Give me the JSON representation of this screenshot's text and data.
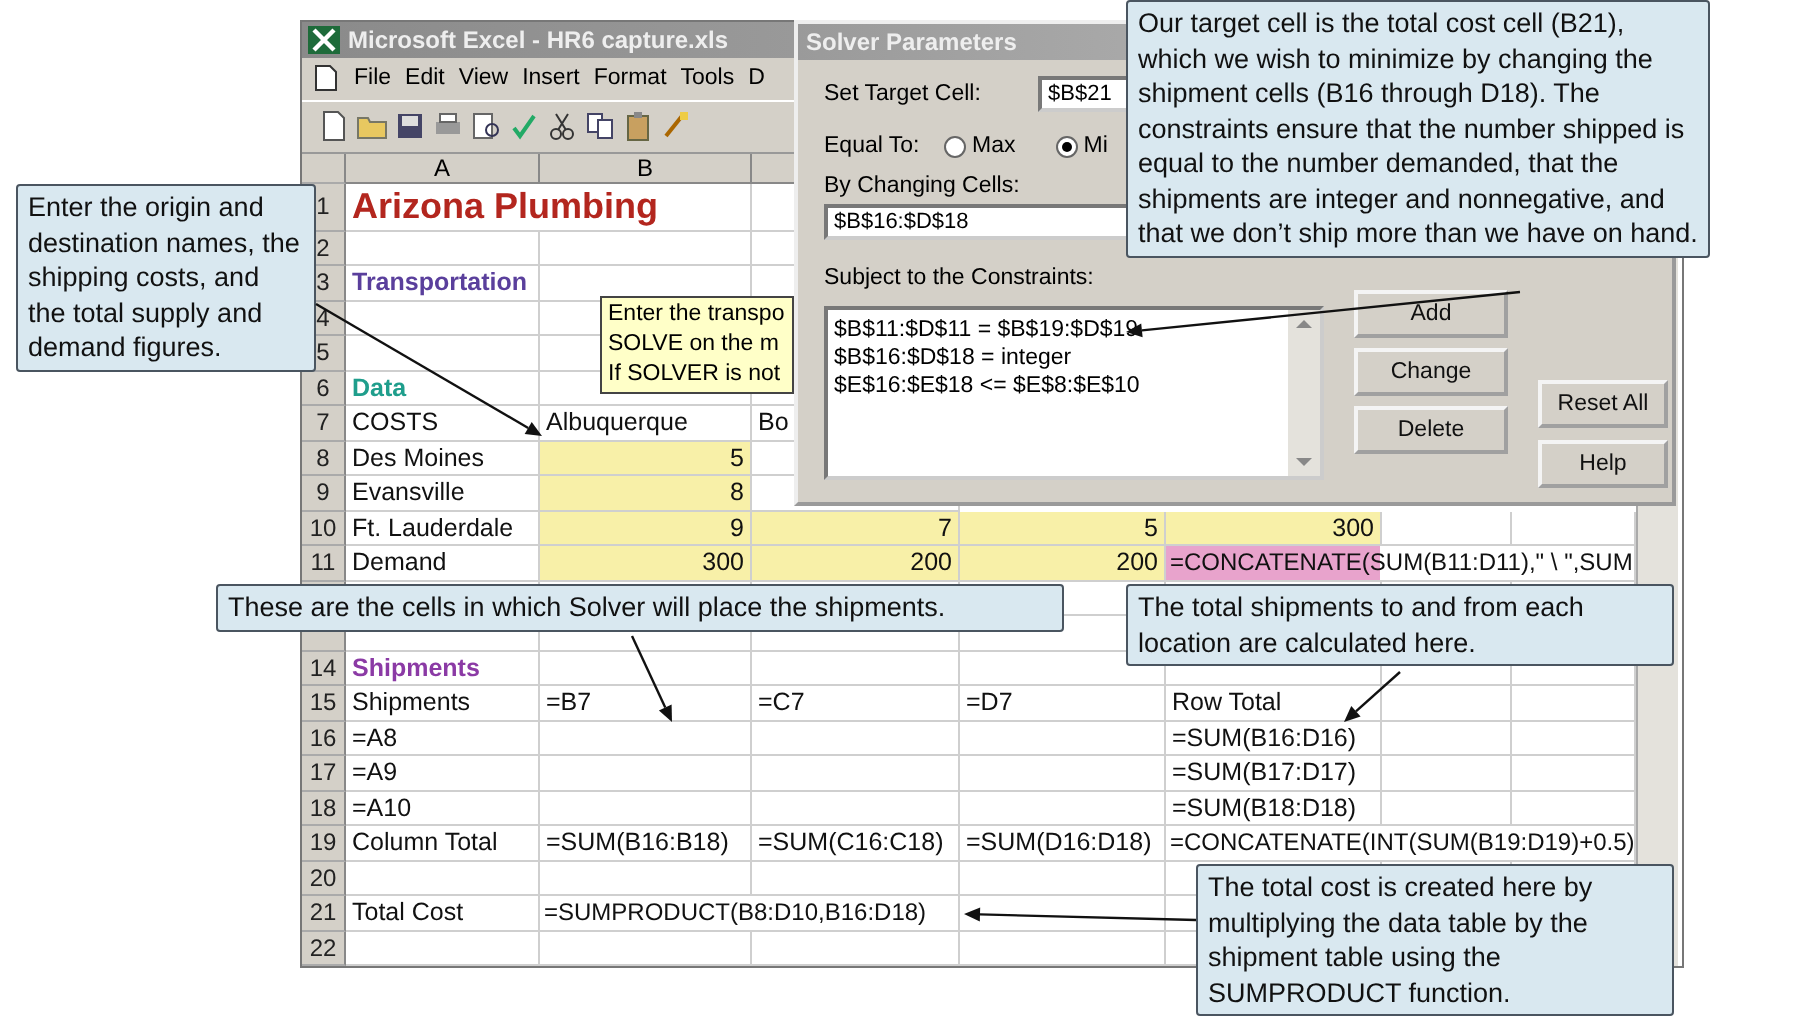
{
  "excel": {
    "title": "Microsoft Excel - HR6 capture.xls",
    "menu": [
      "File",
      "Edit",
      "View",
      "Insert",
      "Format",
      "Tools",
      "D"
    ],
    "columns": [
      "A",
      "B"
    ],
    "rows": [
      {
        "number": "1",
        "a": {
          "text": "Arizona Plumbing",
          "kind": "title"
        }
      },
      {
        "number": "2"
      },
      {
        "number": "3",
        "a": {
          "text": "Transportation",
          "kind": "heading",
          "color": "#5a3f9c"
        }
      },
      {
        "number": "4"
      },
      {
        "number": "5"
      },
      {
        "number": "6",
        "a": {
          "text": "Data",
          "kind": "heading",
          "color": "#1f9e8c"
        }
      },
      {
        "number": "7",
        "a": {
          "text": "COSTS",
          "kind": "text"
        },
        "b": {
          "text": "Albuquerque",
          "kind": "text"
        },
        "c": {
          "text": "Bo",
          "kind": "text"
        }
      },
      {
        "number": "8",
        "a": {
          "text": "Des Moines",
          "kind": "text"
        },
        "b": {
          "text": "5",
          "kind": "number",
          "color": "#f8f0a8"
        }
      },
      {
        "number": "9",
        "a": {
          "text": "Evansville",
          "kind": "text"
        },
        "b": {
          "text": "8",
          "kind": "number",
          "color": "#f8f0a8"
        }
      },
      {
        "number": "10",
        "a": {
          "text": "Ft. Lauderdale",
          "kind": "text"
        },
        "b": {
          "text": "9",
          "kind": "number",
          "color": "#f8f0a8"
        },
        "c": {
          "text": "7",
          "kind": "number",
          "color": "#f8f0a8"
        },
        "d": {
          "text": "5",
          "kind": "number",
          "color": "#f8f0a8"
        },
        "e": {
          "text": "300",
          "kind": "number",
          "color": "#f8f0a8"
        }
      },
      {
        "number": "11",
        "a": {
          "text": "Demand",
          "kind": "text"
        },
        "b": {
          "text": "300",
          "kind": "number",
          "color": "#f8f0a8"
        },
        "c": {
          "text": "200",
          "kind": "number",
          "color": "#f8f0a8"
        },
        "d": {
          "text": "200",
          "kind": "number",
          "color": "#f8f0a8"
        },
        "e": {
          "text": "=CONCATENATE(SUM(B11:D11),\" \\ \",SUM",
          "kind": "overflow",
          "color": "#e8a3cc"
        }
      },
      {},
      {},
      {
        "number": "14",
        "a": {
          "text": "Shipments",
          "kind": "heading",
          "color": "#8b3aa5"
        }
      },
      {
        "number": "15",
        "a": {
          "text": "Shipments",
          "kind": "text"
        },
        "b": {
          "text": "=B7",
          "kind": "text"
        },
        "c": {
          "text": "=C7",
          "kind": "text"
        },
        "d": {
          "text": "=D7",
          "kind": "text"
        },
        "e": {
          "text": "Row Total",
          "kind": "text"
        }
      },
      {
        "number": "16",
        "a": {
          "text": "=A8",
          "kind": "text"
        },
        "e": {
          "text": "=SUM(B16:D16)",
          "kind": "text"
        }
      },
      {
        "number": "17",
        "a": {
          "text": "=A9",
          "kind": "text"
        },
        "e": {
          "text": "=SUM(B17:D17)",
          "kind": "text"
        }
      },
      {
        "number": "18",
        "a": {
          "text": "=A10",
          "kind": "text"
        },
        "e": {
          "text": "=SUM(B18:D18)",
          "kind": "text"
        }
      },
      {
        "number": "19",
        "a": {
          "text": "Column Total",
          "kind": "text"
        },
        "b": {
          "text": "=SUM(B16:B18)",
          "kind": "text"
        },
        "c": {
          "text": "=SUM(C16:C18)",
          "kind": "text"
        },
        "d": {
          "text": "=SUM(D16:D18)",
          "kind": "text"
        },
        "e": {
          "text": "=CONCATENATE(INT(SUM(B19:D19)+0.5)",
          "kind": "overflow"
        }
      },
      {
        "number": "20"
      },
      {
        "number": "21",
        "a": {
          "text": "Total Cost",
          "kind": "text"
        },
        "b": {
          "text": "=SUMPRODUCT(B8:D10,B16:D18)",
          "kind": "overflow"
        }
      },
      {
        "number": "22"
      }
    ]
  },
  "comment": {
    "lines": [
      "Enter the transpo",
      "SOLVE on the m",
      "If SOLVER is not"
    ]
  },
  "solver": {
    "title": "Solver Parameters",
    "target_label": "Set Target Cell:",
    "target_value": "$B$21",
    "equal_label": "Equal To:",
    "options": [
      {
        "label": "Max",
        "selected": false
      },
      {
        "label": "Mi",
        "selected": true
      }
    ],
    "changing_label": "By Changing Cells:",
    "changing_value": "$B$16:$D$18",
    "constraints_label": "Subject to the Constraints:",
    "constraints": [
      "$B$11:$D$11 = $B$19:$D$19",
      "$B$16:$D$18 = integer",
      "$E$16:$E$18 <= $E$8:$E$10"
    ],
    "buttons": [
      "Add",
      "Change",
      "Delete"
    ],
    "side_buttons": [
      "Reset All",
      "Help"
    ]
  },
  "callouts": [
    {
      "kind": "origins",
      "text": "Enter the origin and destination names, the shipping costs, and the total supply and demand figures."
    },
    {
      "kind": "target",
      "text": "Our target cell is the total cost cell (B21), which we wish to minimize by changing the shipment cells (B16 through D18). The constraints ensure that the number shipped is equal to the number demanded, that the shipments are integer and nonnegative, and that we don’t ship more than we have on hand."
    },
    {
      "kind": "cells",
      "text": "These are the cells in which Solver will place the shipments."
    },
    {
      "kind": "totals",
      "text": "The total shipments to and from each location are calculated here."
    },
    {
      "kind": "cost",
      "text": "The total cost is created here by multiplying the data table by the shipment table using the SUMPRODUCT function."
    }
  ]
}
